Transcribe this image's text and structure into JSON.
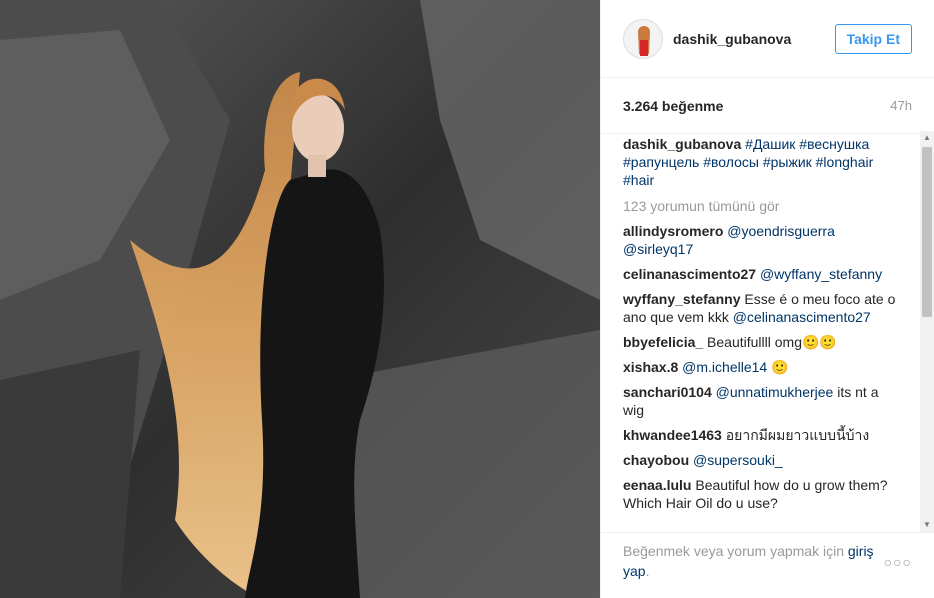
{
  "post": {
    "username": "dashik_gubanova",
    "follow_label": "Takip Et",
    "likes": "3.264 beğenme",
    "time": "47h"
  },
  "comments": [
    {
      "user": "dashik_gubanova",
      "text": "",
      "tags": "#Дашик #веснушка #рапунцель #волосы #рыжик #longhair #hair"
    },
    {
      "more": "123 yorumun tümünü gör"
    },
    {
      "user": "allindysromero",
      "text": "",
      "tags": "@yoendrisguerra @sirleyq17"
    },
    {
      "user": "celinanascimento27",
      "text": "",
      "tags": "@wyffany_stefanny"
    },
    {
      "user": "wyffany_stefanny",
      "text": "Esse é o meu foco ate o ano que vem kkk",
      "tags": "@celinanascimento27"
    },
    {
      "user": "bbyefelicia_",
      "text": "Beautifullll omg🙂🙂",
      "tags": ""
    },
    {
      "user": "xishax.8",
      "text": "",
      "tags": "@m.ichelle14",
      "after": "🙂"
    },
    {
      "user": "sanchari0104",
      "text": "",
      "tags": "@unnatimukherjee",
      "after": "its nt a wig"
    },
    {
      "user": "khwandee1463",
      "text": "อยากมีผมยาวแบบนี้บ้าง",
      "tags": ""
    },
    {
      "user": "chayobou",
      "text": "",
      "tags": "@supersouki_"
    },
    {
      "user": "eenaa.lulu",
      "text": "Beautiful how do u grow them?Which Hair Oil do u use?",
      "tags": ""
    }
  ],
  "footer": {
    "prompt": "Beğenmek veya yorum yapmak için",
    "login": "giriş yap",
    "period": "."
  },
  "icons": {
    "more": "more-options-icon",
    "scroll_up": "scroll-up-arrow-icon",
    "scroll_down": "scroll-down-arrow-icon"
  },
  "colors": {
    "accent": "#3897f0",
    "link": "#003569",
    "muted": "#999999"
  }
}
